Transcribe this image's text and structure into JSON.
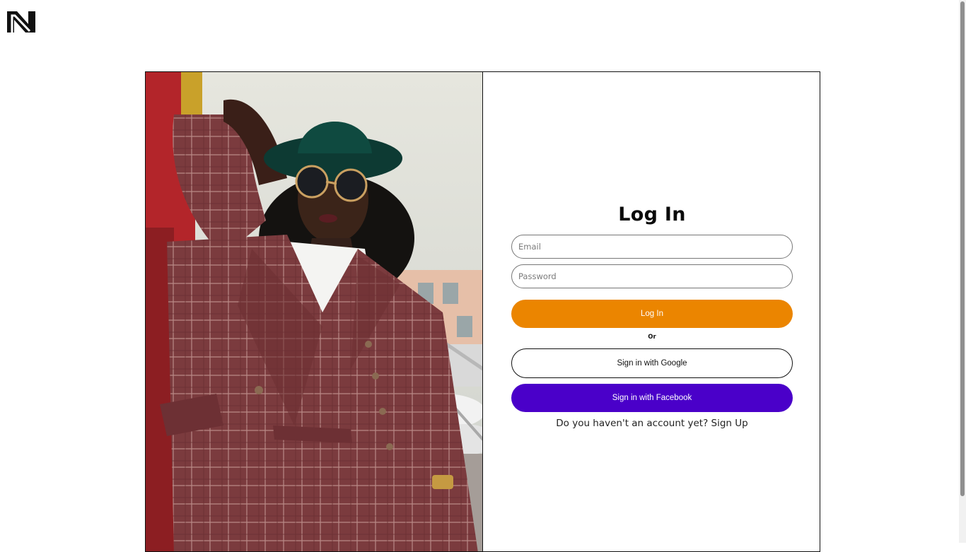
{
  "brand": {
    "logo_icon": "n-logo-icon"
  },
  "login": {
    "title": "Log In",
    "email_placeholder": "Email",
    "password_placeholder": "Password",
    "login_button": "Log In",
    "divider": "Or",
    "google_button": "Sign in with Google",
    "facebook_button": "Sign in with Facebook",
    "signup_prompt": "Do you haven't an account yet?",
    "signup_link": "Sign Up"
  },
  "colors": {
    "accent_orange": "#eb8500",
    "facebook_purple": "#4a00c9",
    "border": "#111111"
  }
}
